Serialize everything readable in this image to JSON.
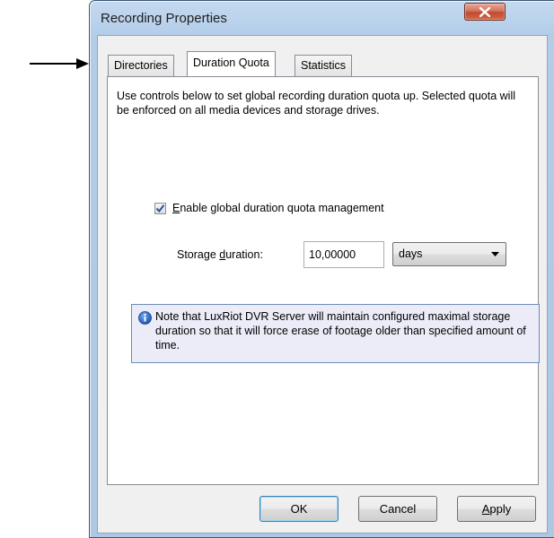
{
  "window": {
    "title": "Recording Properties",
    "close_label": "X"
  },
  "tabs": [
    {
      "label": "Directories",
      "active": false
    },
    {
      "label": "Duration Quota",
      "active": true
    },
    {
      "label": "Statistics",
      "active": false
    }
  ],
  "panel": {
    "intro_text": "Use controls below to set global recording duration quota up. Selected quota will be enforced on all media devices and storage drives.",
    "enable_checkbox": {
      "checked": true,
      "label_mnemonic": "E",
      "label_rest": "nable global duration quota management"
    },
    "storage_duration": {
      "label_before": "Storage ",
      "label_mnemonic": "d",
      "label_after": "uration:",
      "value": "10,00000",
      "unit": "days"
    },
    "info_note": "Note that LuxRiot DVR Server will maintain configured maximal storage duration so that it will force erase of footage older than specified amount of time."
  },
  "buttons": {
    "ok": "OK",
    "cancel": "Cancel",
    "apply_mnemonic": "A",
    "apply_rest": "pply"
  },
  "colors": {
    "accent_info": "#1e56b0",
    "checkmark": "#2b4d9a",
    "close_button": "#c24a2e"
  },
  "icons": [
    "pointer-arrow",
    "close-icon",
    "checkmark-icon",
    "dropdown-chevron-icon",
    "info-icon"
  ]
}
